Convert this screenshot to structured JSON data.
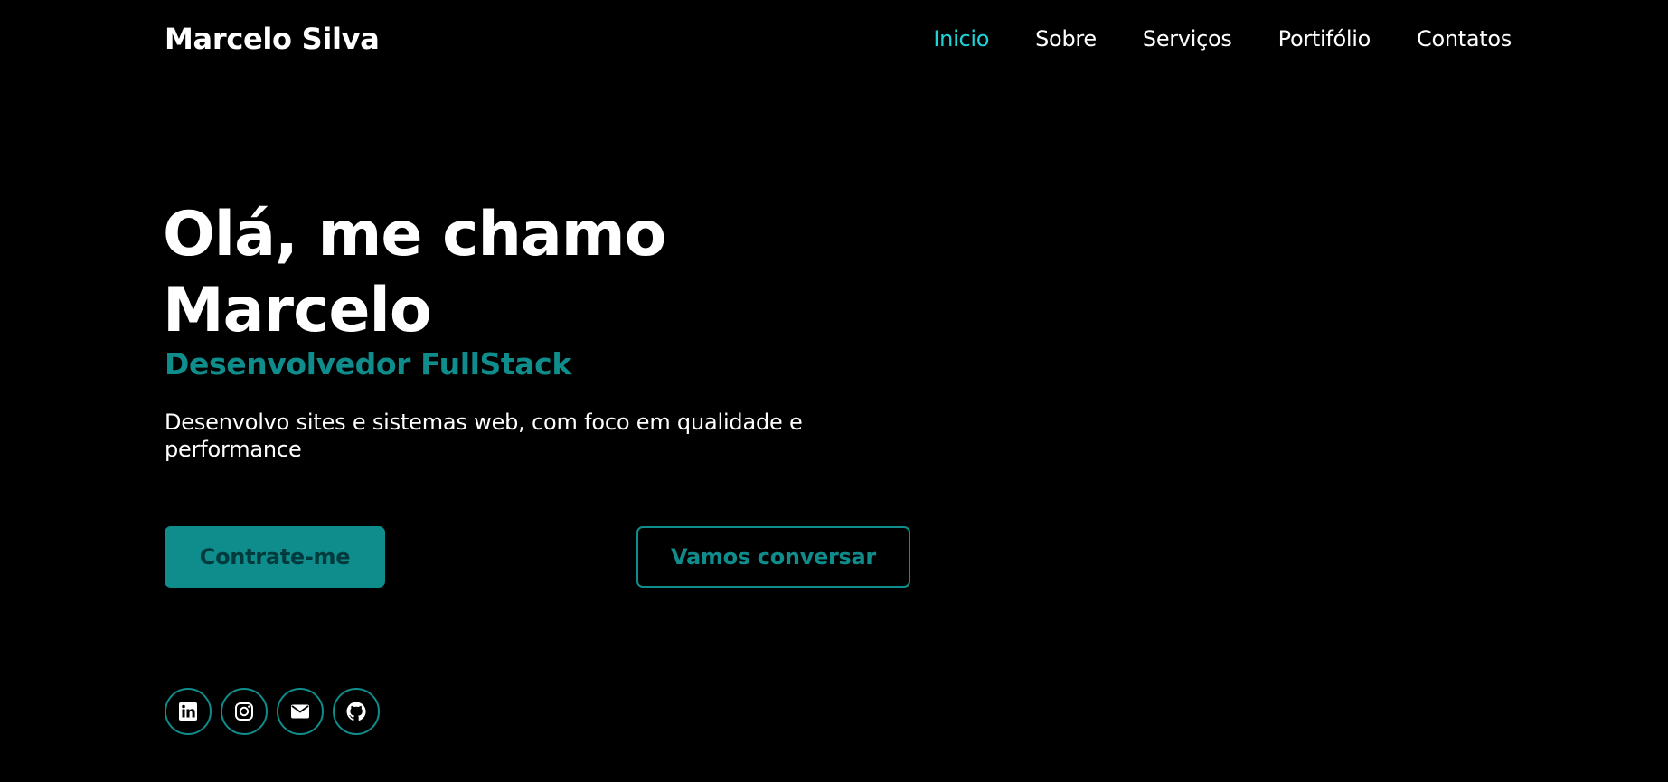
{
  "header": {
    "brand": "Marcelo Silva",
    "nav": [
      {
        "label": "Inicio",
        "active": true
      },
      {
        "label": "Sobre",
        "active": false
      },
      {
        "label": "Serviços",
        "active": false
      },
      {
        "label": "Portifólio",
        "active": false
      },
      {
        "label": "Contatos",
        "active": false
      }
    ]
  },
  "hero": {
    "title_line1": "Olá, me chamo",
    "title_line2": "Marcelo",
    "subtitle": "Desenvolvedor FullStack",
    "description": "Desenvolvo sites e sistemas web, com foco em qualidade e performance"
  },
  "buttons": {
    "primary_label": "Contrate-me",
    "secondary_label": "Vamos conversar"
  },
  "social": [
    {
      "icon": "linkedin-icon"
    },
    {
      "icon": "instagram-icon"
    },
    {
      "icon": "email-icon"
    },
    {
      "icon": "github-icon"
    }
  ],
  "colors": {
    "background": "#000000",
    "accent": "#0f8c8c",
    "nav_active": "#1ed3d8",
    "text": "#ffffff"
  }
}
